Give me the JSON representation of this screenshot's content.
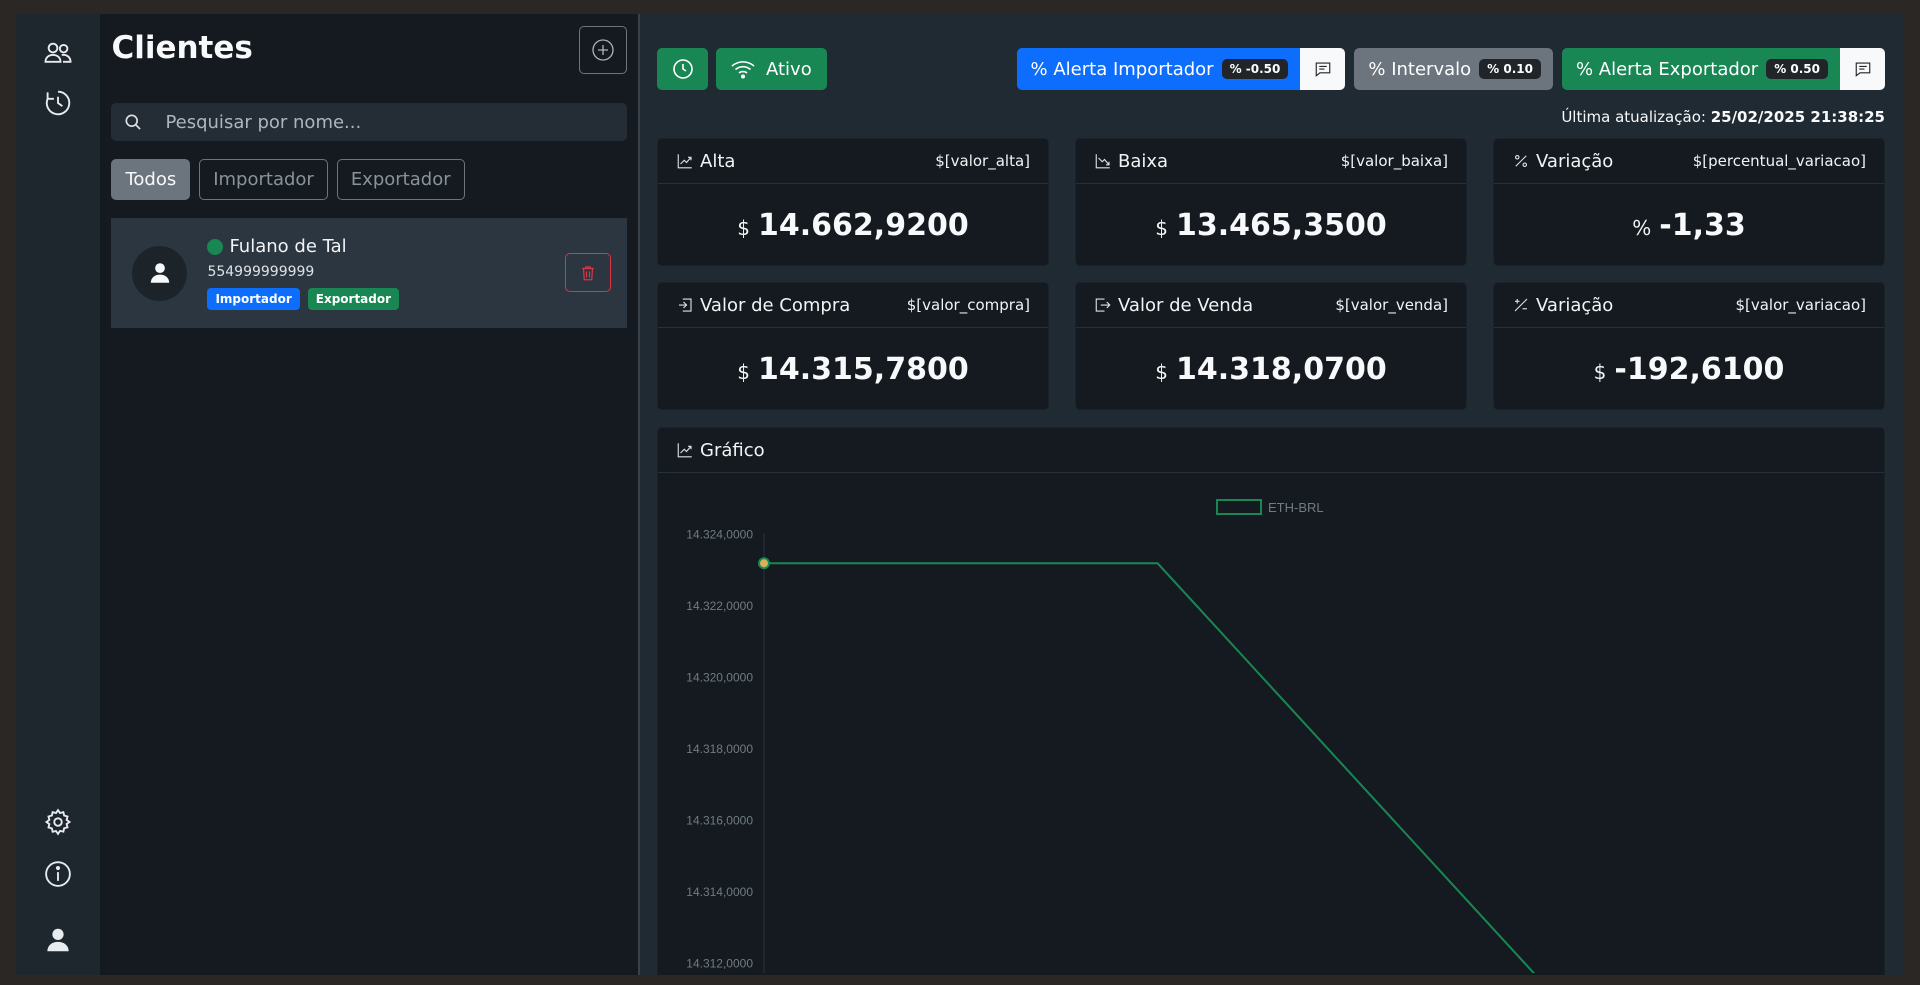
{
  "sidebar": {
    "top_icons": [
      "users-icon",
      "history-icon"
    ],
    "bottom_icons": [
      "gear-icon",
      "info-icon",
      "user-icon"
    ]
  },
  "clients": {
    "title": "Clientes",
    "search_placeholder": "Pesquisar por nome...",
    "filters": [
      "Todos",
      "Importador",
      "Exportador"
    ],
    "active_filter": "Todos",
    "list": [
      {
        "name": "Fulano de Tal",
        "phone": "554999999999",
        "online": true,
        "badges": [
          "Importador",
          "Exportador"
        ]
      }
    ]
  },
  "toolbar": {
    "status_label": "Ativo",
    "alert_importer_label": "% Alerta Importador",
    "alert_importer_value": "% -0.50",
    "interval_label": "% Intervalo",
    "interval_value": "% 0.10",
    "alert_exporter_label": "% Alerta Exportador",
    "alert_exporter_value": "% 0.50"
  },
  "last_update": {
    "label": "Última atualização:",
    "value": "25/02/2025 21:38:25"
  },
  "cards": [
    {
      "title": "Alta",
      "icon": "trend-up-icon",
      "template": "$[valor_alta]",
      "unit": "$",
      "value": "14.662,9200"
    },
    {
      "title": "Baixa",
      "icon": "trend-down-icon",
      "template": "$[valor_baixa]",
      "unit": "$",
      "value": "13.465,3500"
    },
    {
      "title": "Variação",
      "icon": "percent-icon",
      "template": "$[percentual_variacao]",
      "unit": "%",
      "value": "-1,33"
    },
    {
      "title": "Valor de Compra",
      "icon": "box-arrow-in-icon",
      "template": "$[valor_compra]",
      "unit": "$",
      "value": "14.315,7800"
    },
    {
      "title": "Valor de Venda",
      "icon": "box-arrow-out-icon",
      "template": "$[valor_venda]",
      "unit": "$",
      "value": "14.318,0700"
    },
    {
      "title": "Variação",
      "icon": "plus-slash-minus-icon",
      "template": "$[valor_variacao]",
      "unit": "$",
      "value": "-192,6100"
    }
  ],
  "chart": {
    "title": "Gráfico",
    "line_color": "#198754"
  },
  "chart_data": {
    "type": "line",
    "series": [
      {
        "name": "ETH-BRL",
        "x": [
          0,
          1,
          2
        ],
        "values": [
          14323.2,
          14323.2,
          14311.2
        ]
      }
    ],
    "y_ticks": [
      "14.324,0000",
      "14.322,0000",
      "14.320,0000",
      "14.318,0000",
      "14.316,0000",
      "14.314,0000",
      "14.312,0000"
    ],
    "y_tick_values": [
      14324,
      14322,
      14320,
      14318,
      14316,
      14314,
      14312
    ],
    "ylim": [
      14311.0,
      14325.0
    ],
    "legend_position": "top-center",
    "grid": false
  }
}
